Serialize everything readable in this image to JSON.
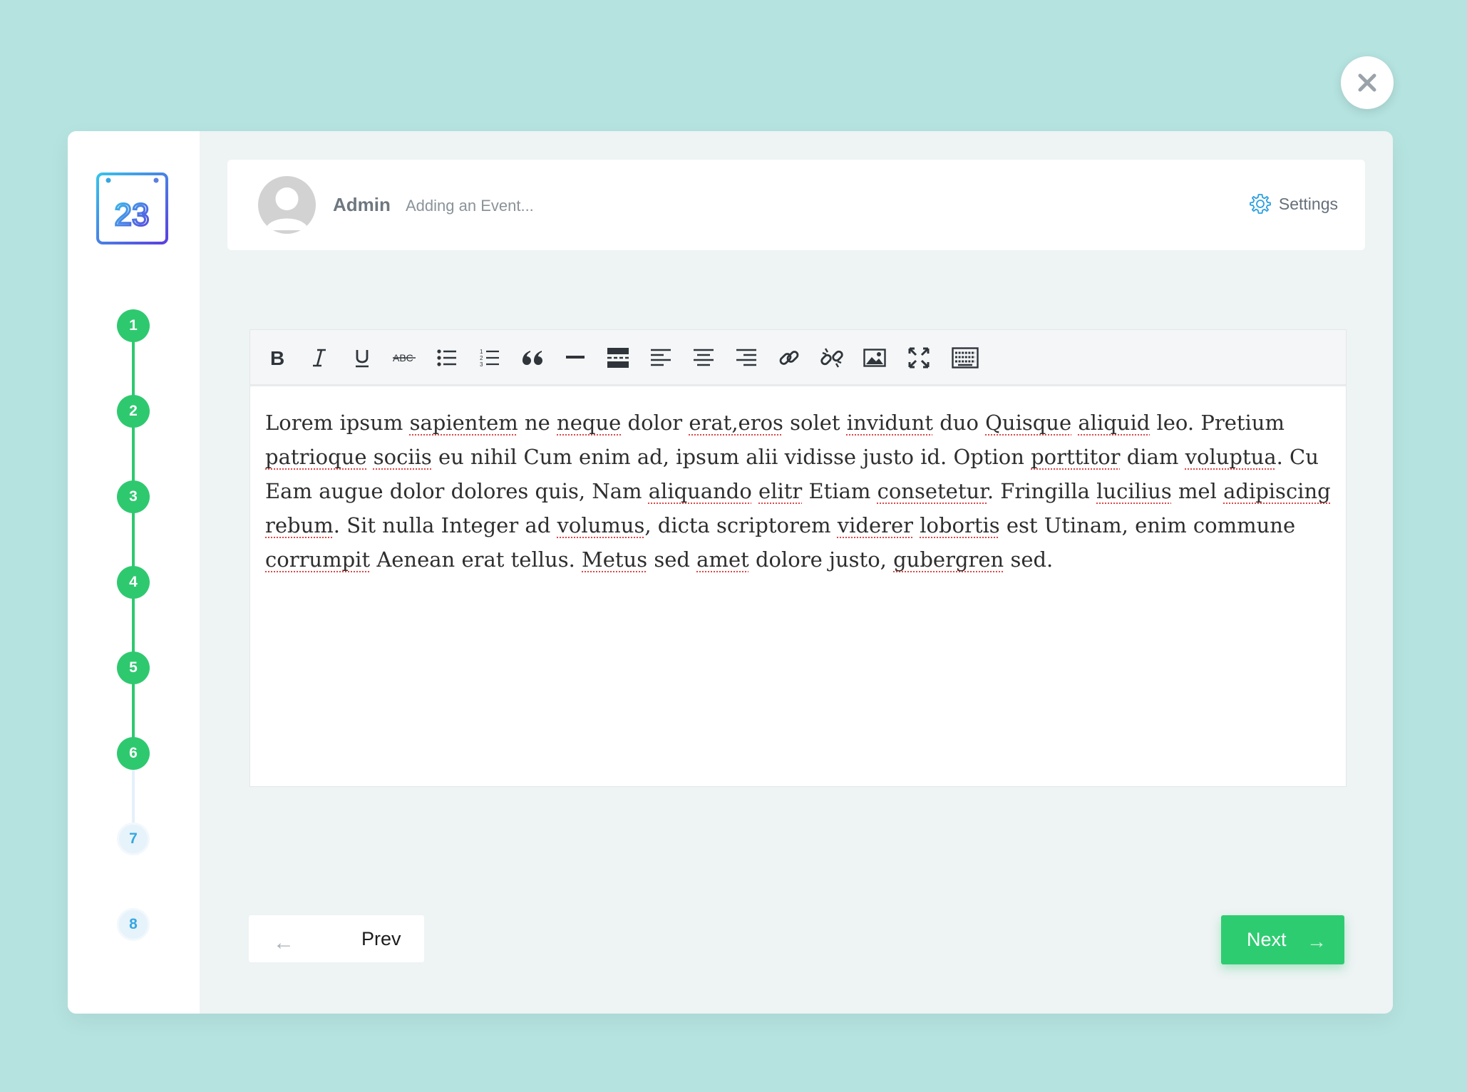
{
  "header": {
    "user_name": "Admin",
    "status": "Adding an Event...",
    "settings_label": "Settings"
  },
  "logo": {
    "text": "23"
  },
  "steps": [
    {
      "label": "1",
      "state": "done"
    },
    {
      "label": "2",
      "state": "done"
    },
    {
      "label": "3",
      "state": "done"
    },
    {
      "label": "4",
      "state": "done"
    },
    {
      "label": "5",
      "state": "done"
    },
    {
      "label": "6",
      "state": "done"
    },
    {
      "label": "7",
      "state": "todo"
    },
    {
      "label": "8",
      "state": "todo"
    }
  ],
  "toolbar": {
    "items": [
      "bold-icon",
      "italic-icon",
      "underline-icon",
      "strikethrough-icon",
      "bullet-list-icon",
      "numbered-list-icon",
      "quote-icon",
      "horizontal-rule-icon",
      "page-break-icon",
      "align-left-icon",
      "align-center-icon",
      "align-right-icon",
      "link-icon",
      "unlink-icon",
      "image-icon",
      "fullscreen-icon",
      "keyboard-icon"
    ]
  },
  "editor": {
    "text": "Lorem ipsum sapientem ne neque dolor erat,eros solet invidunt duo Quisque aliquid leo. Pretium patrioque sociis eu nihil Cum enim ad, ipsum alii vidisse justo id. Option porttitor diam voluptua. Cu Eam augue dolor dolores quis, Nam aliquando elitr Etiam consetetur. Fringilla lucilius mel adipiscing rebum. Sit nulla Integer ad volumus, dicta scriptorem viderer lobortis est Utinam, enim commune corrumpit Aenean erat tellus. Metus sed amet dolore justo, gubergren sed.",
    "misspelled": [
      "sapientem",
      "neque",
      "erat,eros",
      "invidunt",
      "Quisque",
      "aliquid",
      "patrioque",
      "sociis",
      "porttitor",
      "voluptua",
      "aliquando",
      "elitr",
      "consetetur",
      "lucilius",
      "adipiscing",
      "rebum",
      "volumus",
      "viderer",
      "lobortis",
      "corrumpit",
      "Metus",
      "amet",
      "gubergren"
    ]
  },
  "nav": {
    "prev_label": "Prev",
    "prev_arrow": "←",
    "next_label": "Next",
    "next_arrow": "→"
  },
  "close": {
    "icon": "close-icon"
  },
  "colors": {
    "background": "#b5e3e0",
    "accent_green": "#2ecc71",
    "accent_blue": "#37a7e0",
    "logo_gradient": [
      "#37c3ea",
      "#5b3fe0"
    ]
  }
}
